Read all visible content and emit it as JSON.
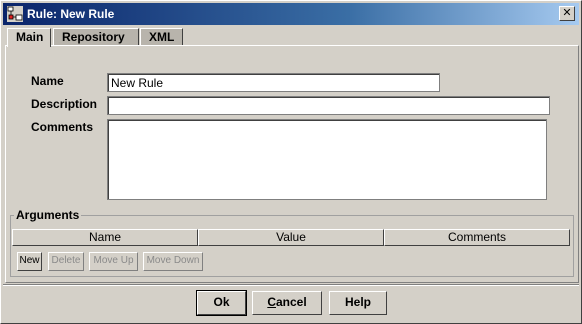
{
  "window": {
    "title": "Rule: New Rule",
    "icon": "rule-diagram-icon",
    "close_glyph": "✕"
  },
  "tabs": [
    {
      "label": "Main",
      "active": true
    },
    {
      "label": "Repository",
      "active": false
    },
    {
      "label": "XML",
      "active": false
    }
  ],
  "form": {
    "name_label": "Name",
    "name_value": "New Rule",
    "description_label": "Description",
    "description_value": "",
    "comments_label": "Comments",
    "comments_value": ""
  },
  "arguments": {
    "legend": "Arguments",
    "columns": [
      "Name",
      "Value",
      "Comments"
    ],
    "rows": [],
    "buttons": {
      "new": "New",
      "delete": "Delete",
      "move_up": "Move Up",
      "move_down": "Move Down"
    }
  },
  "dialog_buttons": {
    "ok": "Ok",
    "cancel_first": "C",
    "cancel_rest": "ancel",
    "help": "Help"
  }
}
